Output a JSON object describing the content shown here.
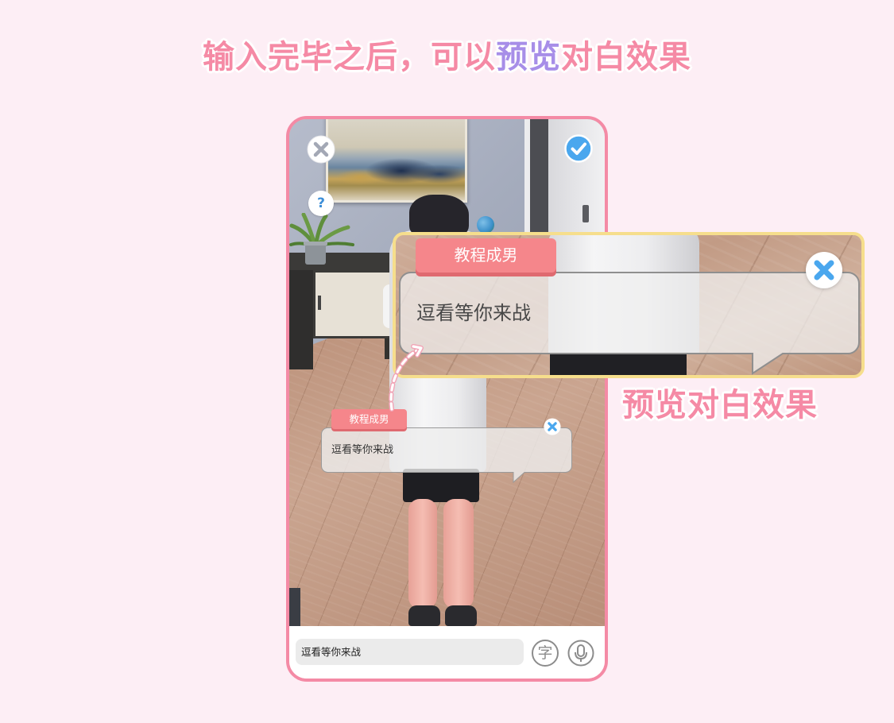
{
  "header": {
    "title_before": "输入完毕之后，可以",
    "title_highlight": "预览",
    "title_after": "对白效果"
  },
  "phone": {
    "top_bar": {
      "exit_icon": "close-icon",
      "confirm_icon": "check-icon",
      "help_label": "?"
    },
    "dialog_bubble": {
      "speaker": "教程成男",
      "text": "逗看等你来战",
      "delete_icon": "close-icon"
    },
    "input_bar": {
      "value": "逗看等你来战",
      "text_style_label": "字",
      "voice_icon": "microphone-icon"
    }
  },
  "zoom_callout": {
    "speaker": "教程成男",
    "text": "逗看等你来战",
    "delete_icon": "close-icon",
    "caption": "预览对白效果"
  },
  "colors": {
    "background": "#fdeef5",
    "title_pink": "#f58aa5",
    "title_highlight": "#a78ee8",
    "phone_border": "#f48aa5",
    "speaker_tag": "#f5868b",
    "confirm_blue": "#4aa7ee",
    "callout_border": "#f6de8c"
  }
}
